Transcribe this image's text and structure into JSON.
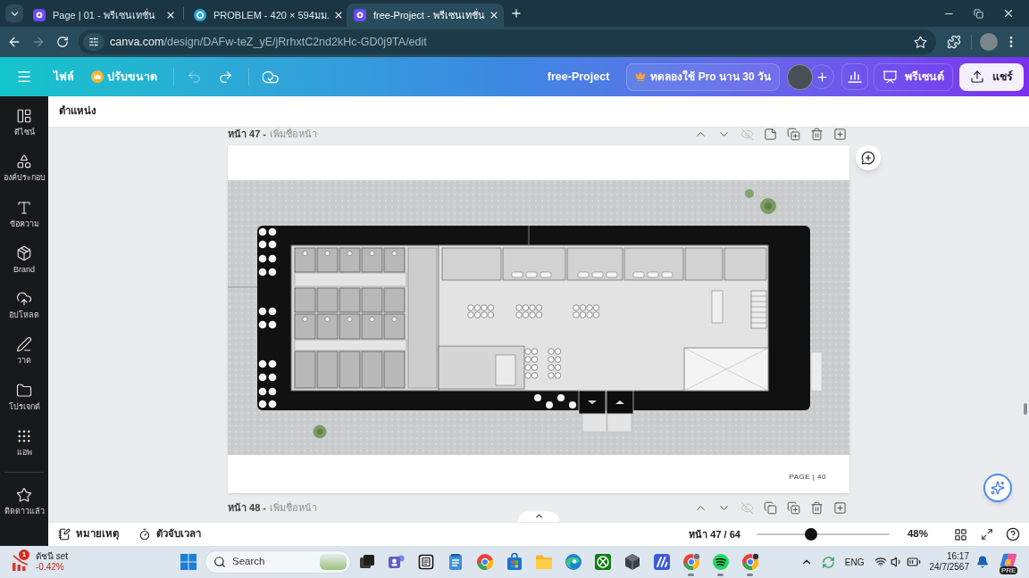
{
  "browser": {
    "tabs": [
      {
        "kind": "presentation",
        "title": "Page | 01 - พรีเซนเทชั่น",
        "selected": false
      },
      {
        "kind": "design",
        "title": "PROBLEM - 420 × 594มม.",
        "selected": false
      },
      {
        "kind": "presentation",
        "title": "free-Project - พรีเซนเทชั่น",
        "selected": true
      }
    ],
    "address": {
      "host": "canva.com",
      "path": "/design/DAFw-teZ_yE/jRrhxtC2nd2kHc-GD0j9TA/edit"
    },
    "forward_disabled": true
  },
  "toolbar": {
    "file": "ไฟล์",
    "resize": "ปรับขนาด",
    "undo_disabled": true,
    "design_title": "free-Project",
    "pro_trial": "ทดลองใช้ Pro นาน 30 วัน",
    "present": "พรีเซนต์",
    "share": "แชร์"
  },
  "sidebar": {
    "items": [
      {
        "kind": "design",
        "label": "ดีไซน์",
        "selected": false
      },
      {
        "kind": "elements",
        "label": "องค์ประกอบ",
        "selected": false
      },
      {
        "kind": "text",
        "label": "ข้อความ",
        "selected": false
      },
      {
        "kind": "brand",
        "label": "Brand",
        "selected": false
      },
      {
        "kind": "uploads",
        "label": "อัปโหลด",
        "selected": false
      },
      {
        "kind": "draw",
        "label": "วาด",
        "selected": false
      },
      {
        "kind": "projects",
        "label": "โปรเจกต์",
        "selected": false
      },
      {
        "kind": "apps",
        "label": "แอพ",
        "selected": false
      }
    ],
    "bottom_items": [
      {
        "kind": "starred",
        "label": "ติดดาวแล้ว",
        "selected": false
      }
    ]
  },
  "position_bar": {
    "label": "ตำแหน่ง"
  },
  "pages": [
    {
      "label": "หน้า 47 -",
      "title_placeholder": "เพิ่มชื่อหน้า",
      "footer": "PAGE | 40"
    },
    {
      "label": "หน้า 48 -",
      "title_placeholder": "เพิ่มชื่อหน้า"
    }
  ],
  "footer": {
    "notes": "หมายเหตุ",
    "timer": "ตัวจับเวลา",
    "page_count": "หน้า 47 / 64",
    "zoom": {
      "level": 0.41,
      "reading": "48%"
    }
  },
  "taskbar": {
    "widget": {
      "title": "ดัชนี set",
      "change": "-0.42%",
      "badge": "1"
    },
    "search": {
      "placeholder": "Search"
    },
    "apps": [
      {
        "kind": "task-view",
        "running": false
      },
      {
        "kind": "chat",
        "running": false
      },
      {
        "kind": "notebook",
        "running": false
      },
      {
        "kind": "notepad",
        "running": false
      },
      {
        "kind": "browser",
        "running": false
      },
      {
        "kind": "store",
        "running": false
      },
      {
        "kind": "folder",
        "running": false
      },
      {
        "kind": "wave-browser",
        "running": false
      },
      {
        "kind": "game",
        "running": false
      },
      {
        "kind": "cube",
        "running": false
      },
      {
        "kind": "tile",
        "running": false
      },
      {
        "kind": "browser-profile",
        "running": true
      },
      {
        "kind": "music",
        "running": true
      },
      {
        "kind": "browser-badge",
        "running": true
      }
    ],
    "language": "ENG",
    "time": "16:17",
    "date": "24/7/2567",
    "assistant_badge": "PRE"
  }
}
